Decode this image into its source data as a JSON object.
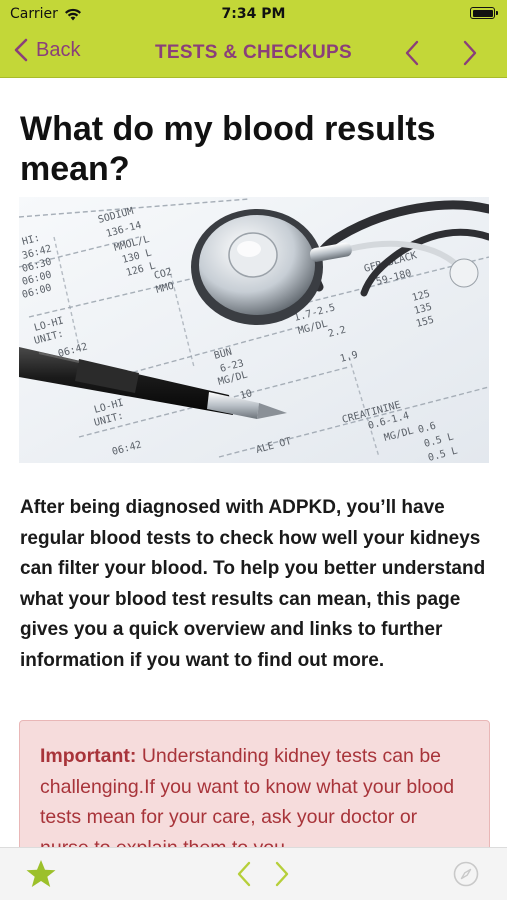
{
  "status_bar": {
    "carrier": "Carrier",
    "time": "7:34 PM"
  },
  "nav": {
    "back_label": "Back",
    "title": "TESTS & CHECKUPS"
  },
  "article": {
    "title": "What do my blood results mean?",
    "intro": "After being diagnosed with ADPKD, you’ll have regular blood tests to check how well your kidneys can filter your blood. To help you better understand what your blood test results can mean, this page gives you a quick overview and links to further information if you want to find out more.",
    "callout": {
      "label": "Important:",
      "text": " Understanding kidney tests can be challenging.If you want to know what your blood tests mean for your care, ask your doctor or nurse to explain them to you."
    },
    "image": {
      "row_labels": [
        "LO-HI UNIT:",
        "06:42",
        "06:30",
        "06:00"
      ],
      "test_labels": [
        "SODIUM",
        "BUN",
        "CREATININE",
        "GFR-BLACK",
        "MG/DL",
        "MMOL/L"
      ],
      "values": [
        "136",
        "130",
        "126",
        "6-23",
        "1.7-2.5",
        "2.2",
        "1.9",
        "0.6-1.4",
        "0.6",
        "0.5",
        "0.5",
        "125",
        "155",
        "59-180"
      ]
    }
  },
  "colors": {
    "accent": "#c3d738",
    "brand_text": "#8a3f7a",
    "callout_bg": "#f6dcdc",
    "callout_text": "#a8343a"
  },
  "icons": [
    "back-chevron-icon",
    "prev-chevron-icon",
    "next-chevron-icon",
    "star-icon",
    "compass-icon",
    "wifi-icon",
    "battery-icon"
  ]
}
